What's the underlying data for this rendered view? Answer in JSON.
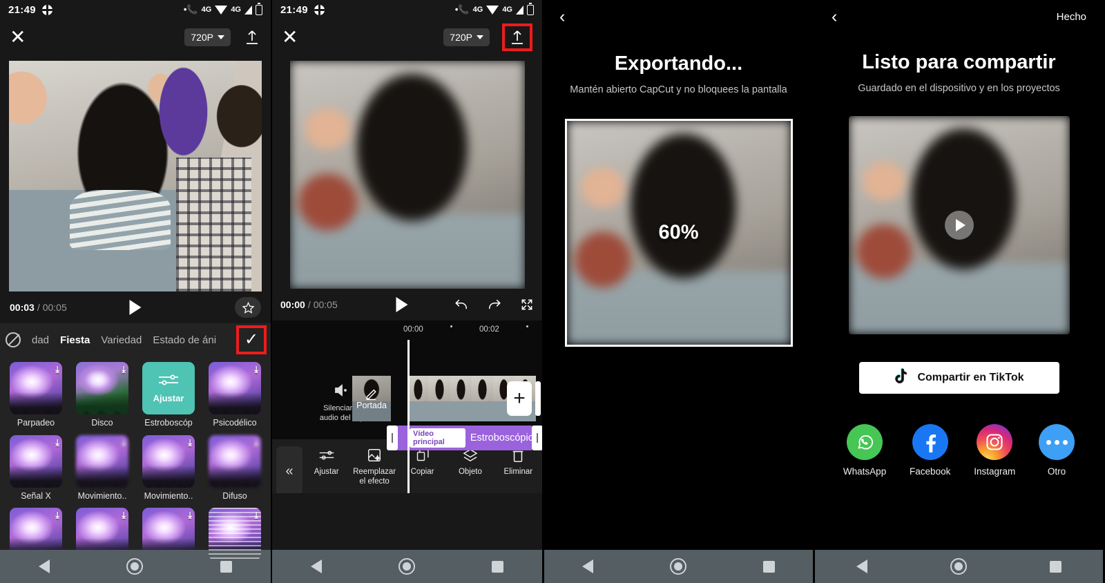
{
  "statusbar": {
    "time": "21:49",
    "network_label": "4G",
    "network_label2": "4G"
  },
  "panel1": {
    "name": "capcut-effects-picker",
    "topbar": {
      "close_icon": "close-icon",
      "resolution": "720P",
      "upload_icon": "upload-icon"
    },
    "player": {
      "current_time": "00:03",
      "separator": "/",
      "total_time": "00:05",
      "play_icon": "play-icon",
      "favorite_icon": "star-icon"
    },
    "tabs": {
      "block_icon": "no-effect-icon",
      "items": [
        {
          "label": "dad",
          "active": false
        },
        {
          "label": "Fiesta",
          "active": true
        },
        {
          "label": "Variedad",
          "active": false
        },
        {
          "label": "Estado de áni",
          "active": false
        }
      ],
      "confirm_icon": "check-icon",
      "highlight_color": "#f01b1b"
    },
    "effects": [
      {
        "label": "Parpadeo",
        "style": "crowd",
        "downloadable": true,
        "selected": false
      },
      {
        "label": "Disco",
        "style": "crowd-green",
        "downloadable": true,
        "selected": false
      },
      {
        "label": "Estroboscóp",
        "style": "adjust",
        "adjust_label": "Ajustar",
        "downloadable": false,
        "selected": true
      },
      {
        "label": "Psicodélico",
        "style": "crowd",
        "downloadable": true,
        "selected": false
      },
      {
        "label": "Señal X",
        "style": "crowd",
        "downloadable": true,
        "selected": false
      },
      {
        "label": "Movimiento..",
        "style": "crowd-blur",
        "downloadable": true,
        "selected": false
      },
      {
        "label": "Movimiento..",
        "style": "crowd",
        "downloadable": true,
        "selected": false
      },
      {
        "label": "Difuso",
        "style": "crowd-blur",
        "downloadable": true,
        "selected": false
      },
      {
        "label": "",
        "style": "crowd",
        "downloadable": true,
        "selected": false
      },
      {
        "label": "",
        "style": "crowd",
        "downloadable": true,
        "selected": false
      },
      {
        "label": "",
        "style": "crowd",
        "downloadable": true,
        "selected": false
      },
      {
        "label": "",
        "style": "crowd-lines",
        "downloadable": true,
        "selected": false
      }
    ]
  },
  "panel2": {
    "name": "capcut-timeline-editor",
    "topbar": {
      "close_icon": "close-icon",
      "resolution": "720P",
      "upload_icon": "upload-icon",
      "upload_highlighted": true
    },
    "player": {
      "current_time": "00:00",
      "separator": "/",
      "total_time": "00:05",
      "play_icon": "play-icon",
      "undo_icon": "undo-icon",
      "redo_icon": "redo-icon",
      "fullscreen_icon": "fullscreen-icon"
    },
    "timeline": {
      "ruler_marks": [
        "00:00",
        "00:02"
      ],
      "mute_label_line1": "Silenciar el",
      "mute_label_line2": "audio del clip",
      "mute_icon": "speaker-icon",
      "cover_label": "Portada",
      "cover_icon": "pencil-icon",
      "add_icon": "plus-icon",
      "effect_badge": "Vídeo principal",
      "effect_name": "Estroboscópico",
      "effect_color": "#9b62dd"
    },
    "toolbar": {
      "collapse_icon": "chevron-double-left-icon",
      "items": [
        {
          "label": "Ajustar",
          "icon": "sliders-icon"
        },
        {
          "label": "Reemplazar el efecto",
          "icon": "replace-effect-icon"
        },
        {
          "label": "Copiar",
          "icon": "copy-icon"
        },
        {
          "label": "Objeto",
          "icon": "layers-icon"
        },
        {
          "label": "Eliminar",
          "icon": "trash-icon"
        }
      ]
    }
  },
  "panel3": {
    "name": "capcut-exporting",
    "back_icon": "chevron-left-icon",
    "title": "Exportando...",
    "subtitle": "Mantén abierto CapCut y no bloquees la pantalla",
    "progress_percent": "60%",
    "progress_value": 60
  },
  "panel4": {
    "name": "capcut-ready-to-share",
    "back_icon": "chevron-left-icon",
    "done_label": "Hecho",
    "title": "Listo para compartir",
    "subtitle": "Guardado en el dispositivo y en los proyectos",
    "play_icon": "play-icon",
    "tiktok_button": {
      "label": "Compartir en TikTok",
      "icon": "tiktok-icon"
    },
    "share_targets": [
      {
        "label": "WhatsApp",
        "icon": "whatsapp-icon",
        "color": "#46c655"
      },
      {
        "label": "Facebook",
        "icon": "facebook-icon",
        "color": "#1977f3"
      },
      {
        "label": "Instagram",
        "icon": "instagram-icon",
        "color": "#d62976"
      },
      {
        "label": "Otro",
        "icon": "more-dots-icon",
        "color": "#3d9ff5"
      }
    ]
  },
  "navbar": {
    "back_icon": "nav-back-icon",
    "home_icon": "nav-home-icon",
    "recents_icon": "nav-recents-icon"
  }
}
